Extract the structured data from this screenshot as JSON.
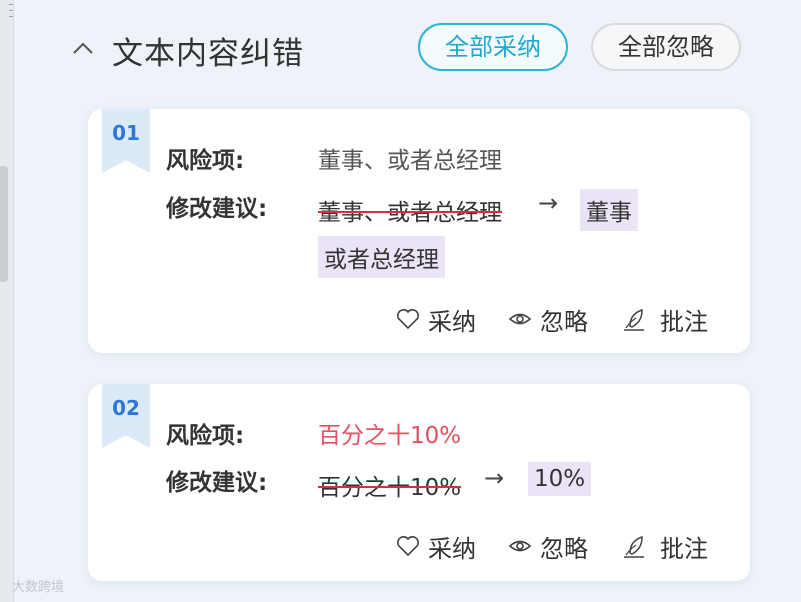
{
  "header": {
    "title": "文本内容纠错",
    "accept_all_label": "全部采纳",
    "ignore_all_label": "全部忽略"
  },
  "labels": {
    "risk": "风险项:",
    "suggestion": "修改建议:"
  },
  "actions": {
    "accept": "采纳",
    "ignore": "忽略",
    "comment": "批注"
  },
  "items": [
    {
      "index": "01",
      "risk_text": "董事、或者总经理",
      "original": "董事、或者总经理",
      "suggestion_1": "董事",
      "suggestion_2": "或者总经理"
    },
    {
      "index": "02",
      "risk_text": "百分之十10%",
      "original": "百分之十10%",
      "suggestion_1": "10%"
    }
  ],
  "watermark": "大数跨境",
  "colors": {
    "accent": "#1ea8d2",
    "risk_red": "#e4505f",
    "strike_red": "#d92e3c",
    "suggestion_bg": "#ebe3f6",
    "ribbon_bg": "#dbeaf8",
    "ribbon_text": "#2f77d6"
  },
  "icons": [
    "chevron-up-icon",
    "heart-icon",
    "eye-icon",
    "quill-icon"
  ]
}
